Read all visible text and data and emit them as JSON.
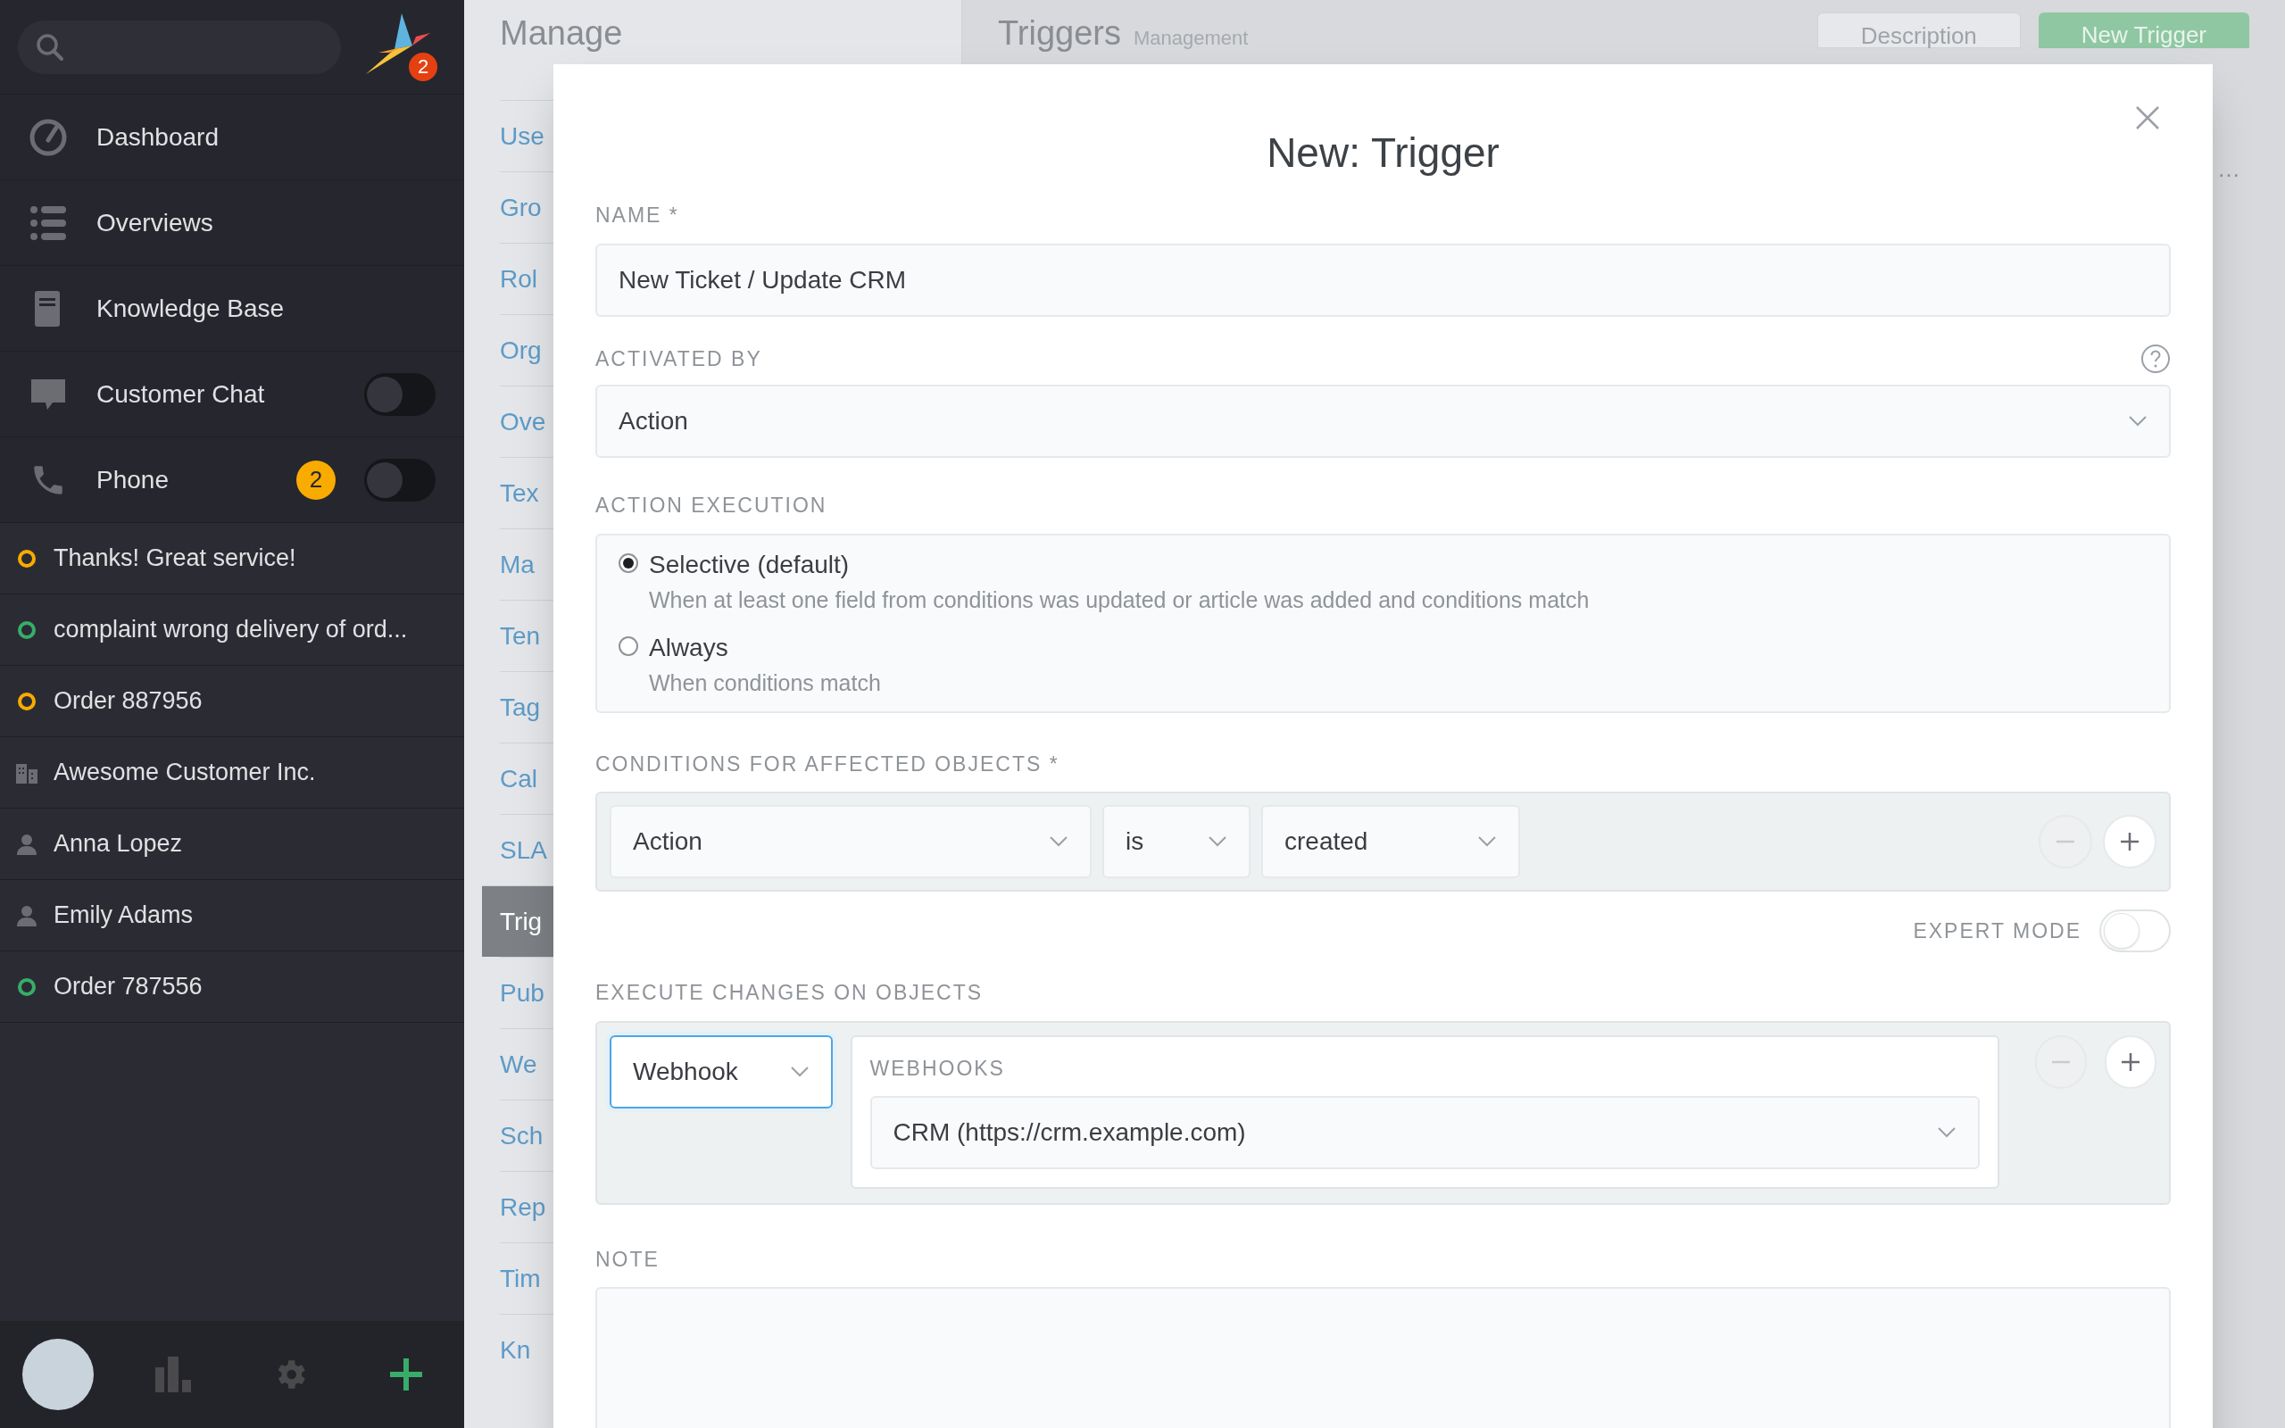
{
  "sidebar": {
    "logo_badge": "2",
    "nav": [
      {
        "label": "Dashboard"
      },
      {
        "label": "Overviews"
      },
      {
        "label": "Knowledge Base"
      },
      {
        "label": "Customer Chat",
        "on": false
      },
      {
        "label": "Phone",
        "badge": "2",
        "on": false
      }
    ],
    "recent": [
      {
        "kind": "ticket",
        "color": "#faab00",
        "label": "Thanks! Great service!"
      },
      {
        "kind": "ticket",
        "color": "#38ad69",
        "label": "complaint wrong delivery of ord..."
      },
      {
        "kind": "ticket",
        "color": "#faab00",
        "label": "Order 887956"
      },
      {
        "kind": "organization",
        "label": "Awesome Customer Inc."
      },
      {
        "kind": "user",
        "label": "Anna Lopez"
      },
      {
        "kind": "user",
        "label": "Emily Adams"
      },
      {
        "kind": "ticket",
        "color": "#38ad69",
        "label": "Order 787556"
      }
    ]
  },
  "manage": {
    "title": "Manage",
    "items": [
      {
        "label": "Use",
        "selected": false
      },
      {
        "label": "Gro",
        "selected": false
      },
      {
        "label": "Rol",
        "selected": false
      },
      {
        "label": "Org",
        "selected": false
      },
      {
        "label": "Ove",
        "selected": false
      },
      {
        "label": "Tex",
        "selected": false
      },
      {
        "label": "Ma",
        "selected": false
      },
      {
        "label": "Ten",
        "selected": false
      },
      {
        "label": "Tag",
        "selected": false
      },
      {
        "label": "Cal",
        "selected": false
      },
      {
        "label": "SLA",
        "selected": false
      },
      {
        "label": "Trig",
        "selected": true
      },
      {
        "label": "Pub",
        "selected": false
      },
      {
        "label": "We",
        "selected": false
      },
      {
        "label": "Sch",
        "selected": false
      },
      {
        "label": "Rep",
        "selected": false
      },
      {
        "label": "Tim",
        "selected": false
      },
      {
        "label": "Kn",
        "selected": false
      }
    ]
  },
  "header": {
    "title": "Triggers",
    "subtitle": "Management",
    "buttons": [
      "Description",
      "New Trigger"
    ],
    "row_more": "…"
  },
  "modal": {
    "title": "New: Trigger",
    "name": {
      "label": "NAME *",
      "value": "New Ticket / Update CRM"
    },
    "activated_by": {
      "label": "ACTIVATED BY",
      "value": "Action"
    },
    "action_execution": {
      "label": "ACTION EXECUTION",
      "options": [
        {
          "label": "Selective (default)",
          "description": "When at least one field from conditions was updated or article was added and conditions match",
          "selected": true
        },
        {
          "label": "Always",
          "description": "When conditions match",
          "selected": false
        }
      ]
    },
    "conditions": {
      "label": "CONDITIONS FOR AFFECTED OBJECTS *",
      "attribute": "Action",
      "operator": "is",
      "value": "created"
    },
    "expert_mode": {
      "label": "EXPERT MODE",
      "on": false
    },
    "execute": {
      "label": "EXECUTE CHANGES ON OBJECTS",
      "type": "Webhook",
      "sub_label": "WEBHOOKS",
      "value": "CRM (https://crm.example.com)"
    },
    "note": {
      "label": "NOTE"
    }
  }
}
